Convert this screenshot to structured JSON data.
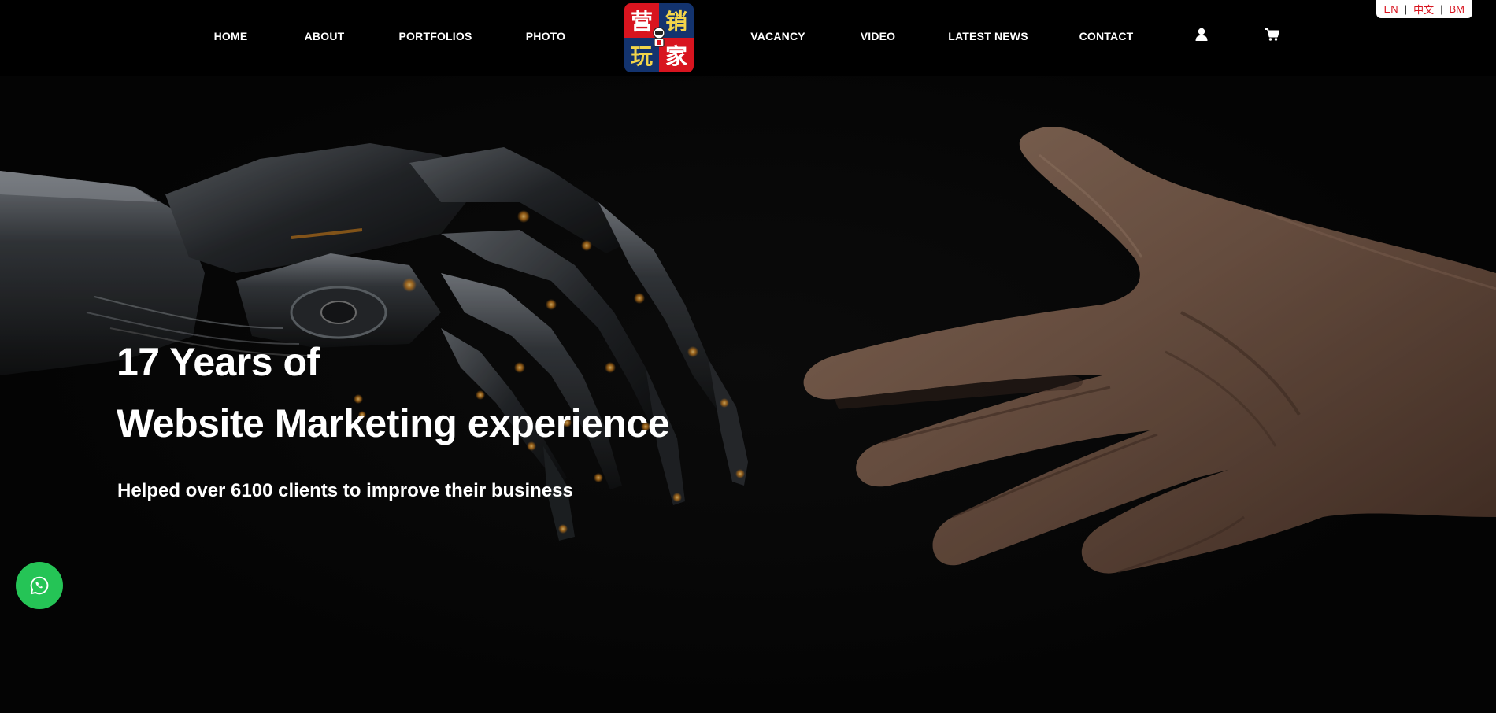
{
  "nav": {
    "left_items": [
      {
        "label": "HOME"
      },
      {
        "label": "ABOUT"
      },
      {
        "label": "PORTFOLIOS"
      },
      {
        "label": "PHOTO"
      }
    ],
    "right_items": [
      {
        "label": "VACANCY"
      },
      {
        "label": "VIDEO"
      },
      {
        "label": "LATEST NEWS"
      },
      {
        "label": "CONTACT"
      }
    ],
    "icons": [
      "user-icon",
      "cart-icon"
    ]
  },
  "logo": {
    "chars": [
      "营",
      "销",
      "玩",
      "家"
    ],
    "colors": {
      "red": "#d8141f",
      "navy": "#13336e",
      "yellow": "#f3d54a"
    }
  },
  "languages": [
    "EN",
    "中文",
    "BM"
  ],
  "hero": {
    "title_line1": "17 Years of",
    "title_line2": "Website Marketing experience",
    "subtitle": "Helped over 6100 clients to improve their business"
  },
  "floating": {
    "icon": "whatsapp-icon",
    "color": "#25c456"
  },
  "colors": {
    "header_bg": "#000000",
    "hero_bg": "#080808",
    "accent": "#d8141f"
  }
}
